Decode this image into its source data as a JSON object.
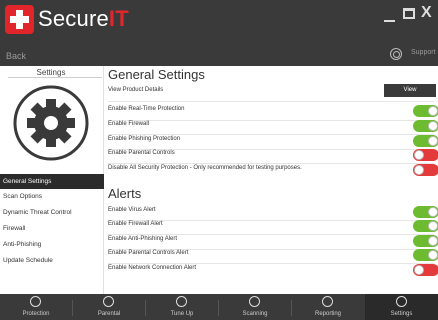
{
  "app": {
    "brand_main": "Secure",
    "brand_accent": "IT",
    "accent_color": "#e0262b"
  },
  "window": {
    "minimize_icon": "minimize-icon",
    "maximize_icon": "maximize-icon",
    "close_label": "X"
  },
  "nav": {
    "back_label": "Back",
    "support_label": "Support"
  },
  "sidebar": {
    "title": "Settings",
    "items": [
      {
        "label": "General Settings",
        "active": true
      },
      {
        "label": "Scan Options"
      },
      {
        "label": "Dynamic Threat Control"
      },
      {
        "label": "Firewall"
      },
      {
        "label": "Anti-Phishing"
      },
      {
        "label": "Update Schedule"
      }
    ]
  },
  "general": {
    "title": "General Settings",
    "view_details_label": "View Product Details",
    "view_button_label": "View",
    "settings": [
      {
        "label": "Enable Real-Time Protection",
        "state": "on"
      },
      {
        "label": "Enable Firewall",
        "state": "on"
      },
      {
        "label": "Enable Phishing Protection",
        "state": "on"
      },
      {
        "label": "Enable Parental Controls",
        "state": "off"
      },
      {
        "label": "Disable All Security Protection - Only recommended for testing purposes.",
        "state": "off"
      }
    ]
  },
  "alerts": {
    "title": "Alerts",
    "settings": [
      {
        "label": "Enable Virus Alert",
        "state": "on"
      },
      {
        "label": "Enable Firewall Alert",
        "state": "on"
      },
      {
        "label": "Enable Anti-Phishing Alert",
        "state": "on"
      },
      {
        "label": "Enable Parental Controls Alert",
        "state": "on"
      },
      {
        "label": "Enable Network Connection Alert",
        "state": "off"
      }
    ]
  },
  "tabs": [
    {
      "label": "Protection",
      "icon": "lock-icon"
    },
    {
      "label": "Parental",
      "icon": "people-icon"
    },
    {
      "label": "Tune Up",
      "icon": "tune-icon"
    },
    {
      "label": "Scanning",
      "icon": "scan-icon"
    },
    {
      "label": "Reporting",
      "icon": "report-icon"
    },
    {
      "label": "Settings",
      "icon": "gear-icon",
      "active": true
    }
  ],
  "colors": {
    "toggle_on": "#6dbb31",
    "toggle_off": "#e33b3b",
    "bar": "#3a3a3a"
  }
}
